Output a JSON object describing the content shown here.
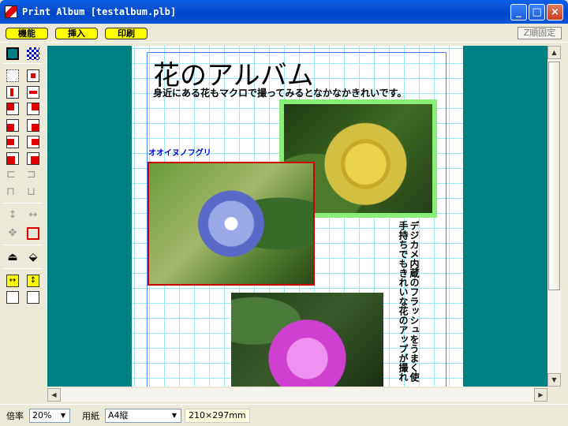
{
  "window": {
    "title": "Print Album [testalbum.plb]"
  },
  "toolbar": {
    "functions": "機能",
    "insert": "挿入",
    "print": "印刷",
    "z_fix": "Z順固定"
  },
  "page": {
    "title": "花のアルバム",
    "subtitle": "身近にある花もマクロで撮ってみるとなかなかきれいです。",
    "caption": "オオイヌノフグリ",
    "vertical_text": "デジカメ内蔵のフラッシュをうまく使手持ちでもきれいな花のアップが撮れ"
  },
  "status": {
    "zoom_label": "倍率",
    "zoom_value": "20%",
    "paper_label": "用紙",
    "paper_value": "A4縦",
    "size_readout": "210×297mm"
  },
  "colors": {
    "canvas": "#008080",
    "titlebar": "#0A5FE8",
    "button_fill": "#FFFF00"
  }
}
